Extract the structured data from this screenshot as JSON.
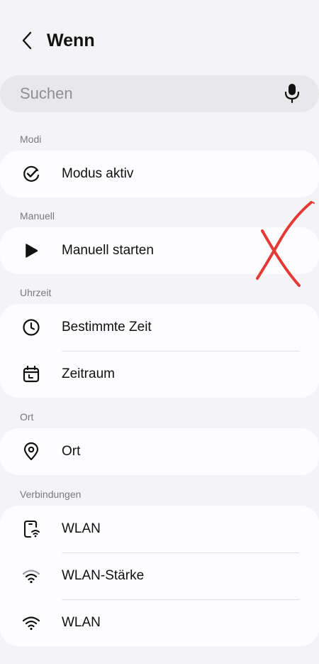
{
  "header": {
    "title": "Wenn"
  },
  "search": {
    "placeholder": "Suchen"
  },
  "sections": [
    {
      "label": "Modi",
      "items": [
        "Modus aktiv"
      ]
    },
    {
      "label": "Manuell",
      "items": [
        "Manuell starten"
      ]
    },
    {
      "label": "Uhrzeit",
      "items": [
        "Bestimmte Zeit",
        "Zeitraum"
      ]
    },
    {
      "label": "Ort",
      "items": [
        "Ort"
      ]
    },
    {
      "label": "Verbindungen",
      "items": [
        "WLAN",
        "WLAN-Stärke",
        "WLAN"
      ]
    }
  ],
  "icons": {
    "back": "chevron-left-icon",
    "mic": "microphone-icon",
    "modus_aktiv": "check-circle-icon",
    "manuell_starten": "play-icon",
    "bestimmte_zeit": "clock-icon",
    "zeitraum": "calendar-icon",
    "ort": "location-pin-icon",
    "wlan_1": "phone-wifi-icon",
    "wlan_staerke": "wifi-strength-icon",
    "wlan_2": "wifi-icon"
  },
  "colors": {
    "annotation_mark": "#e53935",
    "background": "#f4f4f6",
    "card": "#fdfdff"
  }
}
